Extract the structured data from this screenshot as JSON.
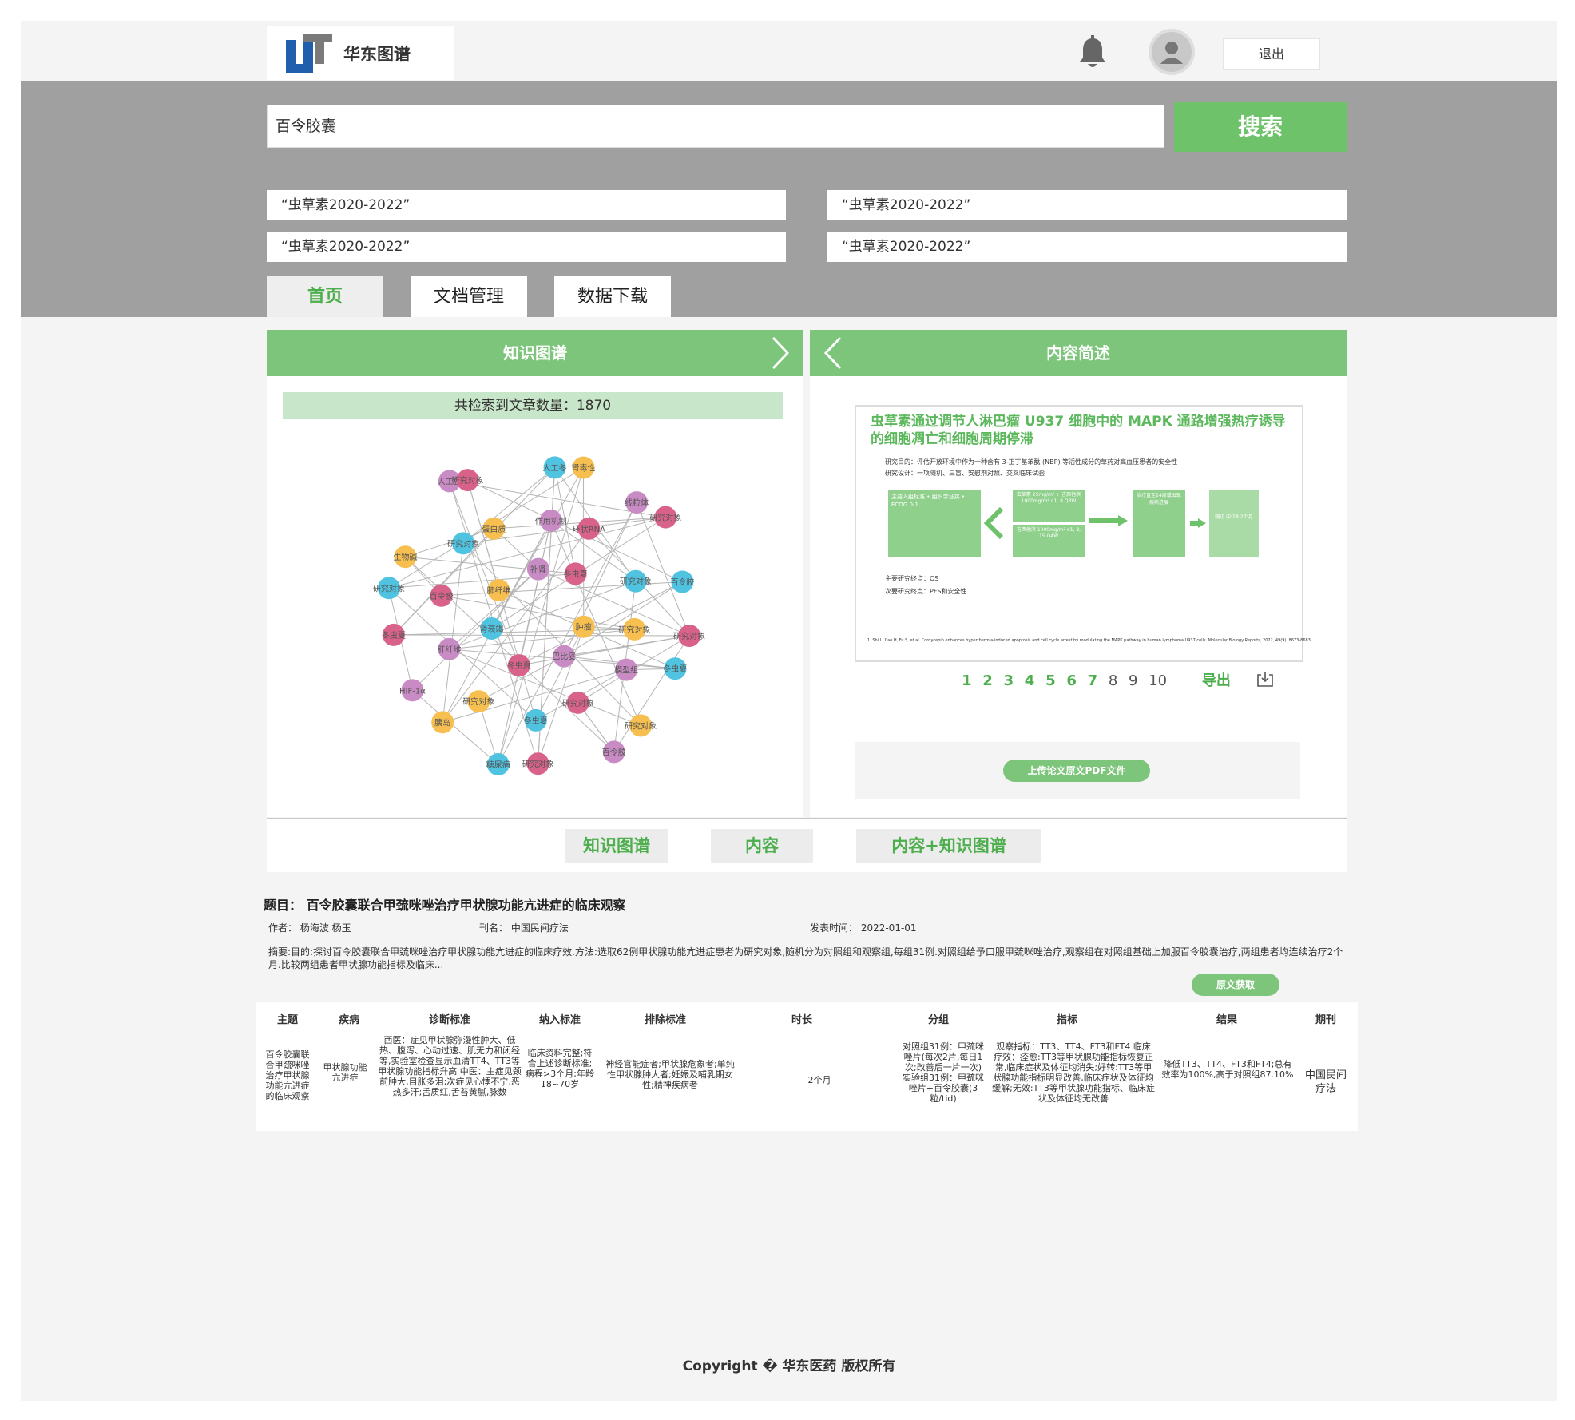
{
  "header": {
    "logo_text": "华东图谱",
    "logout_label": "退出"
  },
  "search": {
    "value": "百令胶囊",
    "button_label": "搜索",
    "suggestions": [
      "“虫草素2020-2022”",
      "“虫草素2020-2022”",
      "“虫草素2020-2022”",
      "“虫草素2020-2022”"
    ]
  },
  "tabs": [
    {
      "label": "首页",
      "active": true
    },
    {
      "label": "文档管理",
      "active": false
    },
    {
      "label": "数据下载",
      "active": false
    }
  ],
  "left_panel": {
    "title": "知识图谱",
    "count_text": "共检索到文章数量：1870",
    "node_labels": [
      "研究对象",
      "冬虫夏",
      "研究对象",
      "百令胶",
      "研究对象",
      "糖尿病",
      "胰岛",
      "HIF-1α",
      "冬虫夏",
      "研究对象",
      "生物碱",
      "人工虫",
      "研究对象",
      "人工冬",
      "肾毒性",
      "线粒体",
      "研究对象",
      "百令胶",
      "研究对象",
      "模型组",
      "研究对象",
      "冬虫夏",
      "研究对象",
      "肝纤维",
      "百令胶",
      "研究对象",
      "蛋白质",
      "作用机制",
      "环状RNA",
      "研究对象",
      "肿瘤",
      "巴比妥",
      "冬虫夏",
      "肾衰竭",
      "肺纤维",
      "补肾",
      "冬虫夏"
    ]
  },
  "right_panel": {
    "title": "内容简述",
    "paper_title": "虫草素通过调节人淋巴瘤 U937 细胞中的 MAPK 通路增强热疗诱导的细胞凋亡和细胞周期停滞",
    "paper_lines": [
      "研究目的：评估开放环境中作为一种含有 3-正丁基苯酞 (NBP) 等活性成分的草药对高血压患者的安全性",
      "研究设计：一项随机、三盲、安慰剂对照、交叉临床试验",
      "主要研究终点：OS",
      "次要研究终点：PFS和安全性",
      "1. Shi L, Cao H, Fu S, et al. Cordycepin enhances hyperthermia-induced apoptosis and cell cycle arrest by modulating the MAPK pathway in human lymphoma U937 cells. Molecular Biology Reports, 2022, 49(9): 8673-8683."
    ],
    "flow_boxes": [
      "主要入组标准 • 组织学证实 • ECOG 0-1",
      "虫草素 25mg/m² + 吉西他滨 1000mg/m² d1, 8 Q3W",
      "吉西他滨 1000mg/m² d1, 8, 15 Q4W",
      "治疗直至24周或出现疾病进展",
      "随访 中位8.2个月"
    ],
    "pager": [
      "1",
      "2",
      "3",
      "4",
      "5",
      "6",
      "7",
      "8",
      "9",
      "10"
    ],
    "export_label": "导出",
    "upload_label": "上传论文原文PDF文件"
  },
  "view_buttons": [
    "知识图谱",
    "内容",
    "内容+知识图谱"
  ],
  "article": {
    "title": "题目：  百令胶囊联合甲巯咪唑治疗甲状腺功能亢进症的临床观察",
    "author": "作者：  杨海波 杨玉",
    "journal": "刊名：  中国民间疗法",
    "date": "发表时间：  2022-01-01",
    "abstract": "摘要:目的:探讨百令胶囊联合甲巯咪唑治疗甲状腺功能亢进症的临床疗效.方法:选取62例甲状腺功能亢进症患者为研究对象,随机分为对照组和观察组,每组31例.对照组给予口服甲巯咪唑治疗,观察组在对照组基础上加服百令胶囊治疗,两组患者均连续治疗2个月.比较两组患者甲状腺功能指标及临床...",
    "get_label": "原文获取"
  },
  "table": {
    "headers": [
      "主题",
      "疾病",
      "诊断标准",
      "纳入标准",
      "排除标准",
      "时长",
      "分组",
      "指标",
      "结果",
      "期刊"
    ],
    "row": [
      "百令胶囊联合甲巯咪唑治疗甲状腺功能亢进症的临床观察",
      "甲状腺功能亢进症",
      "西医：症见甲状腺弥漫性肿大、低热、腹泻、心动过速、肌无力和闭经等,实验室检查显示血清TT4、TT3等甲状腺功能指标升高 中医：主症见颈前肿大,目胀多泪;次症见心悸不宁,恶热多汗;舌质红,舌苔黄腻,脉数",
      "临床资料完整;符合上述诊断标准;病程>3个月;年龄18~70岁",
      "神经官能症者;甲状腺危象者;单纯性甲状腺肿大者;妊娠及哺乳期女性;精神疾病者",
      "2个月",
      "对照组31例：甲巯咪唑片(每次2片,每日1次;改善后一片一次) 实验组31例：甲巯咪唑片+百令胶囊(3粒/tid)",
      "观察指标：TT3、TT4、FT3和FT4 临床疗效：痊愈:TT3等甲状腺功能指标恢复正常,临床症状及体征均消失;好转:TT3等甲状腺功能指标明显改善,临床症状及体征均缓解;无效:TT3等甲状腺功能指标、临床症状及体征均无改善",
      "降低TT3、TT4、FT3和FT4;总有效率为100%,高于对照组87.10%",
      "中国民间疗法"
    ]
  },
  "footer": "Copyright � 华东医药 版权所有",
  "colors": {
    "accent_green": "#6dc26a",
    "header_green": "#7cc57a",
    "band_gray": "#a0a0a0",
    "logo_blue": "#1f5fae",
    "node_pink": "#d9628a",
    "node_blue": "#4fc3e0",
    "node_orange": "#f6bf4f",
    "node_purple": "#c88bc4"
  }
}
